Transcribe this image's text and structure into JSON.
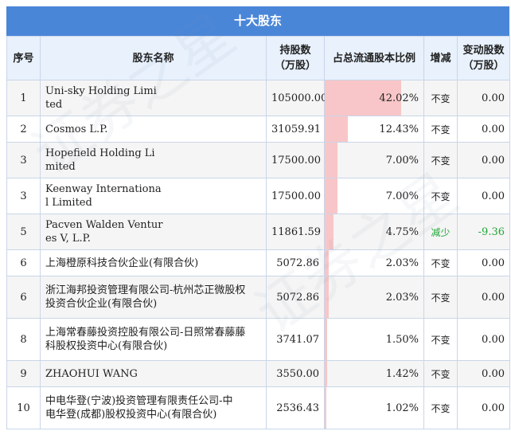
{
  "title": "十大股东",
  "headers": {
    "idx": "序号",
    "name": "股东名称",
    "holding_line1": "持股数",
    "holding_line2": "（万股）",
    "pct": "占总流通股本比例",
    "change": "增减",
    "amount_line1": "变动股数",
    "amount_line2": "（万股）"
  },
  "rows": [
    {
      "idx": "1",
      "name_line1": "Uni-sky Holding Limi",
      "name_line2": "ted",
      "holding": "105000.00",
      "pct": "42.02%",
      "pct_value": 42.02,
      "change": "不变",
      "amount": "0.00"
    },
    {
      "idx": "2",
      "name_line1": "Cosmos L.P.",
      "name_line2": "",
      "holding": "31059.91",
      "pct": "12.43%",
      "pct_value": 12.43,
      "change": "不变",
      "amount": "0.00"
    },
    {
      "idx": "3",
      "name_line1": "Hopefield Holding Li",
      "name_line2": "mited",
      "holding": "17500.00",
      "pct": "7.00%",
      "pct_value": 7.0,
      "change": "不变",
      "amount": "0.00"
    },
    {
      "idx": "3",
      "name_line1": "Keenway Internationa",
      "name_line2": "l Limited",
      "holding": "17500.00",
      "pct": "7.00%",
      "pct_value": 7.0,
      "change": "不变",
      "amount": "0.00"
    },
    {
      "idx": "5",
      "name_line1": "Pacven Walden Ventur",
      "name_line2": "es V, L.P.",
      "holding": "11861.59",
      "pct": "4.75%",
      "pct_value": 4.75,
      "change": "减少",
      "amount": "-9.36"
    },
    {
      "idx": "6",
      "name_line1": "上海橙原科技合伙企业(有限合伙)",
      "name_line2": "",
      "holding": "5072.86",
      "pct": "2.03%",
      "pct_value": 2.03,
      "change": "不变",
      "amount": "0.00"
    },
    {
      "idx": "6",
      "name_line1": "浙江海邦投资管理有限公司-杭州芯正微股权",
      "name_line2": "投资合伙企业(有限合伙)",
      "holding": "5072.86",
      "pct": "2.03%",
      "pct_value": 2.03,
      "change": "不变",
      "amount": "0.00"
    },
    {
      "idx": "8",
      "name_line1": "上海常春藤投资控股有限公司-日照常春藤藤",
      "name_line2": "科股权投资中心(有限合伙)",
      "holding": "3741.07",
      "pct": "1.50%",
      "pct_value": 1.5,
      "change": "不变",
      "amount": "0.00"
    },
    {
      "idx": "9",
      "name_line1": "ZHAOHUI WANG",
      "name_line2": "",
      "holding": "3550.00",
      "pct": "1.42%",
      "pct_value": 1.42,
      "change": "不变",
      "amount": "0.00"
    },
    {
      "idx": "10",
      "name_line1": "中电华登(宁波)投资管理有限责任公司-中",
      "name_line2": "电华登(成都)股权投资中心(有限合伙)",
      "holding": "2536.43",
      "pct": "1.02%",
      "pct_value": 1.02,
      "change": "不变",
      "amount": "0.00"
    }
  ],
  "colors": {
    "header_blue": "#4a86d8",
    "bar_pink": "#f8c6c8",
    "decrease_green": "#22a638"
  }
}
